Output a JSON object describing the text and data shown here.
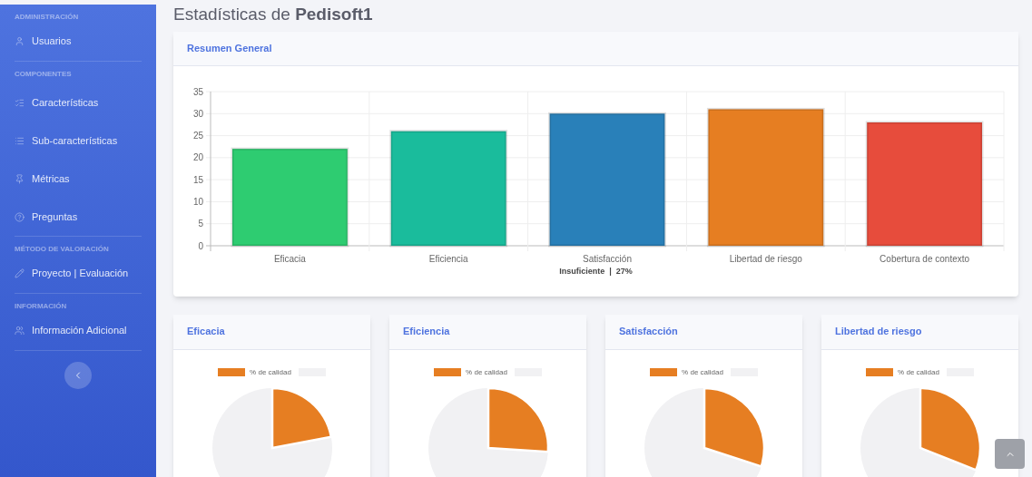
{
  "sidebar": {
    "sections": [
      {
        "heading": "ADMINISTRACIÓN",
        "items": [
          {
            "label": "Usuarios"
          }
        ]
      },
      {
        "heading": "COMPONENTES",
        "items": [
          {
            "label": "Características"
          },
          {
            "label": "Sub-características"
          },
          {
            "label": "Métricas"
          },
          {
            "label": "Preguntas"
          }
        ]
      },
      {
        "heading": "MÉTODO DE VALORACIÓN",
        "items": [
          {
            "label": "Proyecto | Evaluación"
          }
        ]
      },
      {
        "heading": "INFORMACIÓN",
        "items": [
          {
            "label": "Información Adicional"
          }
        ]
      }
    ]
  },
  "page_title": {
    "prefix": "Estadísticas de",
    "name": "Pedisoft1"
  },
  "summary": {
    "title": "Resumen General",
    "result": "Insuficiente  |  27%",
    "chart_data": {
      "type": "bar",
      "grid": true,
      "colors": [
        "#2ecc71",
        "#1abc9c",
        "#2980b9",
        "#e67e22",
        "#e74c3c"
      ],
      "categories": [
        "Eficacia",
        "Eficiencia",
        "Satisfacción",
        "Libertad de riesgo",
        "Cobertura de contexto"
      ],
      "values": [
        22,
        26,
        30,
        31,
        28
      ],
      "ylim": [
        0,
        35
      ],
      "yticks": [
        0,
        5,
        10,
        15,
        20,
        25,
        30,
        35
      ]
    }
  },
  "cards": [
    {
      "title": "Eficacia",
      "legend": "% de calidad"
    },
    {
      "title": "Eficiencia",
      "legend": "% de calidad"
    },
    {
      "title": "Satisfacción",
      "legend": "% de calidad"
    },
    {
      "title": "Libertad de riesgo",
      "legend": "% de calidad"
    }
  ]
}
